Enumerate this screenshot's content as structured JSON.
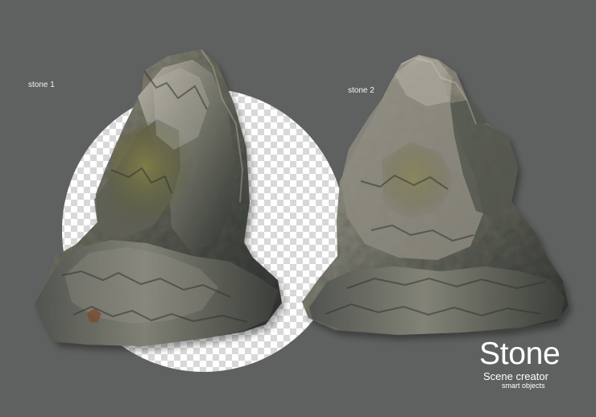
{
  "labels": {
    "stone_1": "stone 1",
    "stone_2": "stone 2"
  },
  "brand": {
    "title": "Stone",
    "subtitle": "Scene creator",
    "tagline": "smart objects"
  },
  "colors": {
    "background": "#5f6060",
    "text": "#ffffff",
    "checker_light": "#ffffff",
    "checker_dark": "#d8d8d8",
    "stone_shadow": "#2c302c",
    "stone_mid": "#67685f",
    "stone_highlight": "#b8b4a8",
    "moss": "#6c6d3c"
  }
}
